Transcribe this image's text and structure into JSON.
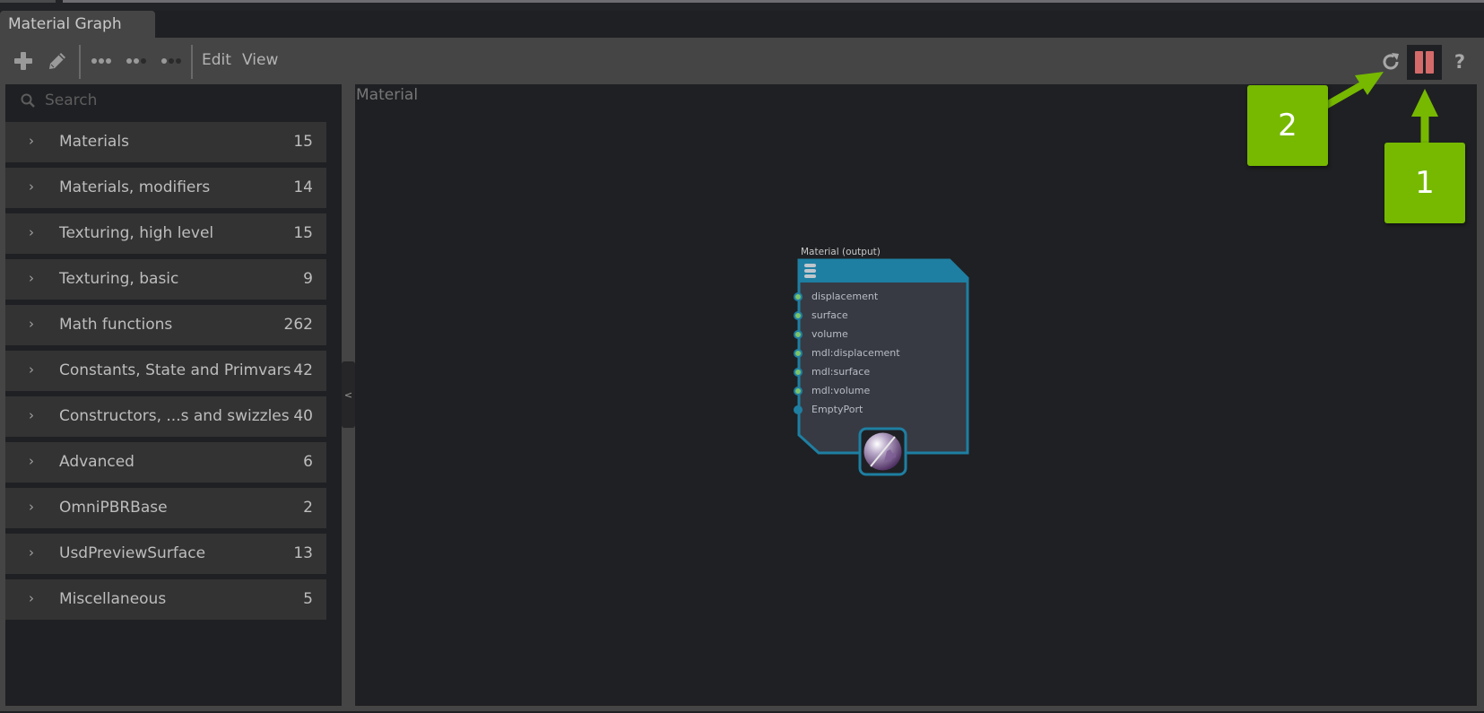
{
  "window": {
    "tab_title": "Material Graph"
  },
  "toolbar": {
    "add_icon": "plus-icon",
    "edit_icon": "pencil-icon",
    "layout_icons": [
      "dots-horizontal-icon",
      "dots-right-dark-icon",
      "dots-left-dark-icon"
    ],
    "menus": [
      {
        "label": "Edit"
      },
      {
        "label": "View"
      }
    ],
    "right_icons": {
      "refresh": "refresh-icon",
      "pause": "pause-icon",
      "help": "?"
    }
  },
  "sidebar": {
    "search": {
      "placeholder": "Search",
      "value": ""
    },
    "categories": [
      {
        "chevron": "›",
        "label": "Materials",
        "count": "15"
      },
      {
        "chevron": "›",
        "label": "Materials, modifiers",
        "count": "14"
      },
      {
        "chevron": "›",
        "label": "Texturing, high level",
        "count": "15"
      },
      {
        "chevron": "›",
        "label": "Texturing, basic",
        "count": "9"
      },
      {
        "chevron": "›",
        "label": "Math functions",
        "count": "262"
      },
      {
        "chevron": "›",
        "label": "Constants, State and Primvars",
        "count": "42"
      },
      {
        "chevron": "›",
        "label": "Constructors, ...s and swizzles",
        "count": "40"
      },
      {
        "chevron": "›",
        "label": "Advanced",
        "count": "6"
      },
      {
        "chevron": "›",
        "label": "OmniPBRBase",
        "count": "2"
      },
      {
        "chevron": "›",
        "label": "UsdPreviewSurface",
        "count": "13"
      },
      {
        "chevron": "›",
        "label": "Miscellaneous",
        "count": "5"
      }
    ],
    "collapse_label": "<"
  },
  "graph": {
    "breadcrumb": "Material",
    "node": {
      "title": "Material (output)",
      "ports": [
        {
          "label": "displacement",
          "connected": true
        },
        {
          "label": "surface",
          "connected": true
        },
        {
          "label": "volume",
          "connected": true
        },
        {
          "label": "mdl:displacement",
          "connected": true
        },
        {
          "label": "mdl:surface",
          "connected": true
        },
        {
          "label": "mdl:volume",
          "connected": true
        },
        {
          "label": "EmptyPort",
          "connected": false
        }
      ]
    }
  },
  "callouts": [
    {
      "label": "1",
      "target": "pause-button"
    },
    {
      "label": "2",
      "target": "refresh-button"
    }
  ],
  "colors": {
    "accent_green": "#76b900",
    "node_header": "#1e7fa2",
    "pause_red": "#d46a6a",
    "port_green": "#7cc46b"
  }
}
